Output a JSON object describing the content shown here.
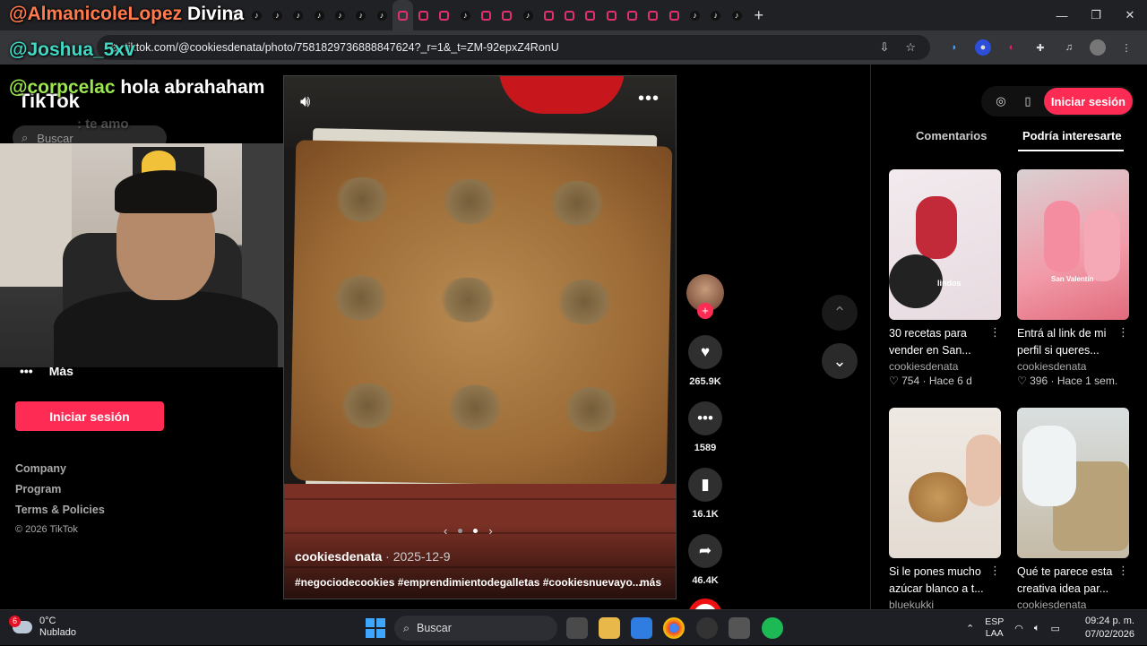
{
  "browser": {
    "url": "tiktok.com/@cookiesdenata/photo/7581829736888847624?_r=1&_t=ZM-92epxZ4RonU",
    "tab_icons": [
      "tt",
      "cr",
      "tt",
      "tt",
      "tt",
      "tt",
      "tt",
      "tt",
      "tt",
      "ig",
      "ig",
      "ig",
      "tt",
      "ig",
      "ig",
      "tt",
      "ig",
      "ig",
      "ig",
      "ig",
      "ig",
      "ig",
      "ig",
      "tt",
      "tt",
      "tt"
    ],
    "new_tab": "+",
    "win_min": "—",
    "win_max": "❐",
    "win_close": "✕"
  },
  "chat": [
    {
      "user": "@AlmanicoleLopez",
      "message": "Divina"
    },
    {
      "user": "@Joshua_5xv",
      "message": ""
    },
    {
      "user": "@corpcelac",
      "message": "hola abrahaham"
    },
    {
      "user": "",
      "message": ": te amo"
    }
  ],
  "sidebar": {
    "logo": "TikTok",
    "search_placeholder": "Buscar",
    "more_label": "Más",
    "login_label": "Iniciar sesión",
    "footer_links": [
      "Company",
      "Program",
      "Terms & Policies"
    ],
    "copyright": "© 2026 TikTok"
  },
  "video": {
    "author": "cookiesdenata",
    "date": "· 2025-12-9",
    "hashtags": "#negociodecookies #emprendimientodegalletas #cookiesnuevayo...",
    "more": "más",
    "slide_count": 3,
    "active_slide": 2
  },
  "actions": {
    "likes": "265.9K",
    "comments": "1589",
    "saves": "16.1K",
    "shares": "46.4K"
  },
  "right_panel": {
    "login_label": "Iniciar sesión",
    "tabs": [
      "Comentarios",
      "Podría interesarte"
    ],
    "active_tab": "Podría interesarte",
    "cards": [
      {
        "title": "30 recetas para vender en San...",
        "author": "cookiesdenata",
        "likes": "754",
        "age": "Hace 6 d",
        "thumb_text": "lindos"
      },
      {
        "title": "Entrá al link de mi perfil si queres...",
        "author": "cookiesdenata",
        "likes": "396",
        "age": "Hace 1 sem.",
        "thumb_text": "San Valentín"
      },
      {
        "title": "Si le pones mucho azúcar blanco a t...",
        "author": "bluekukki",
        "likes": "",
        "age": ""
      },
      {
        "title": "Qué te parece esta creativa idea par...",
        "author": "cookiesdenata",
        "likes": "",
        "age": ""
      }
    ]
  },
  "taskbar": {
    "temperature": "0°C",
    "weather": "Nublado",
    "weather_badge": "6",
    "search_label": "Buscar",
    "lang_line1": "ESP",
    "lang_line2": "LAA",
    "time": "09:24 p. m.",
    "date": "07/02/2026"
  },
  "colors": {
    "accent": "#fe2c55",
    "background": "#000000"
  }
}
